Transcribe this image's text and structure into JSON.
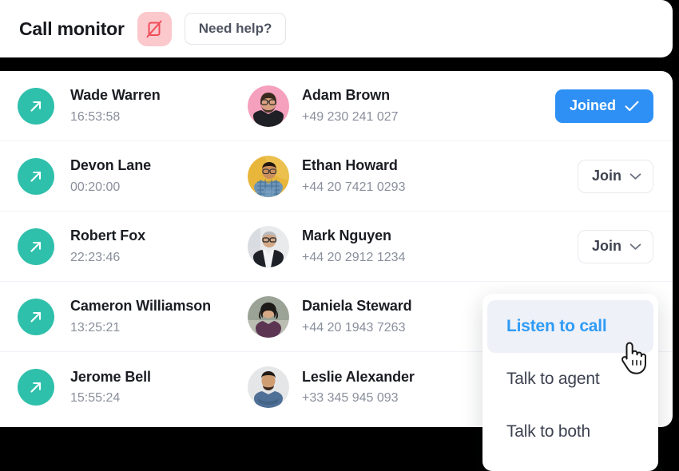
{
  "header": {
    "title": "Call monitor",
    "mute_icon": "monitor-off-icon",
    "help_label": "Need help?"
  },
  "accent_colors": {
    "direction_icon_teal": "#2fc0ac",
    "joined_blue": "#2e90f5",
    "menu_active_blue": "#2e9bf5",
    "mute_icon_bg": "#fbc8cc",
    "mute_icon_stroke": "#ef4c56"
  },
  "call_list": {
    "rows": [
      {
        "direction_icon": "arrow-outgoing-icon",
        "agent_name": "Wade Warren",
        "duration": "16:53:58",
        "contact_name": "Adam Brown",
        "contact_phone": "+49 230 241 027",
        "avatar": "avatar-adam-brown",
        "action": "joined",
        "action_label": "Joined"
      },
      {
        "direction_icon": "arrow-outgoing-icon",
        "agent_name": "Devon Lane",
        "duration": "00:20:00",
        "contact_name": "Ethan Howard",
        "contact_phone": "+44 20 7421 0293",
        "avatar": "avatar-ethan-howard",
        "action": "join",
        "action_label": "Join"
      },
      {
        "direction_icon": "arrow-outgoing-icon",
        "agent_name": "Robert Fox",
        "duration": "22:23:46",
        "contact_name": "Mark Nguyen",
        "contact_phone": "+44 20 2912 1234",
        "avatar": "avatar-mark-nguyen",
        "action": "join",
        "action_label": "Join"
      },
      {
        "direction_icon": "arrow-outgoing-icon",
        "agent_name": "Cameron Williamson",
        "duration": "13:25:21",
        "contact_name": "Daniela Steward",
        "contact_phone": "+44 20 1943 7263",
        "avatar": "avatar-daniela-steward",
        "action": "none",
        "action_label": ""
      },
      {
        "direction_icon": "arrow-outgoing-icon",
        "agent_name": "Jerome Bell",
        "duration": "15:55:24",
        "contact_name": "Leslie Alexander",
        "contact_phone": "+33 345 945 093",
        "avatar": "avatar-leslie-alexander",
        "action": "none",
        "action_label": ""
      }
    ]
  },
  "dropdown": {
    "items": [
      {
        "label": "Listen to call",
        "active": true
      },
      {
        "label": "Talk to agent",
        "active": false
      },
      {
        "label": "Talk to both",
        "active": false
      }
    ]
  },
  "cursor": {
    "icon": "pointing-hand-cursor"
  }
}
